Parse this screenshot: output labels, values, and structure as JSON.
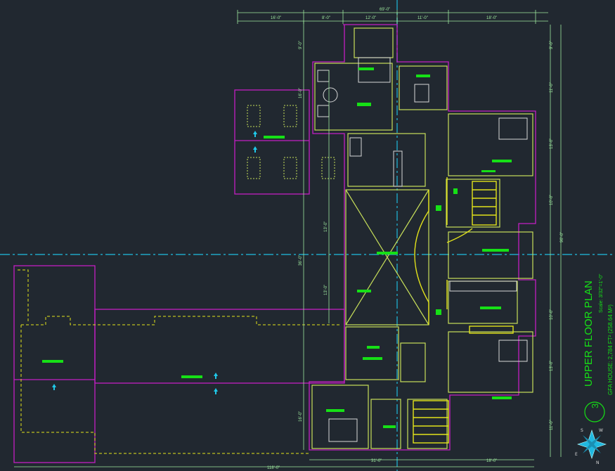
{
  "title": "UPPER FLOOR PLAN",
  "scale": "Scale: 3/32\"=1'-0\"",
  "gfa": "GFA HOUSE: 2,784 FT² (258.64 M²)",
  "number": "3",
  "compass": {
    "n": "N",
    "s": "S",
    "e": "E",
    "w": "W"
  },
  "dims": {
    "top_overall": "69'-0\"",
    "top_1": "16'-0\"",
    "top_2": "8'-0\"",
    "top_3": "12'-0\"",
    "top_4": "11'-0\"",
    "top_5": "18'-0\"",
    "bottom_overall": "118'-0\"",
    "bottom_1": "31'-0\"",
    "bottom_2": "18'-0\"",
    "right_overall": "96'-0\"",
    "right_1": "9'-0\"",
    "right_2": "11'-0\"",
    "right_3": "13'-0\"",
    "right_4": "10'-0\"",
    "right_5": "10'-0\"",
    "right_6": "13'-0\"",
    "right_7": "11'-0\"",
    "left_overall": "36'-0\"",
    "left_1": "9'-0\"",
    "left_2": "16'-0\"",
    "left_3": "13'-0\"",
    "left_4": "13'-0\"",
    "left_5": "16'-0\""
  },
  "colors": {
    "background": "#212830",
    "wall": "#c8e05a",
    "outline": "#c21ec2",
    "label": "#16e016",
    "dimension": "#9ee89e",
    "axis": "#1fa5c4",
    "stair": "#e3e31a",
    "compass": "#20b8e0"
  }
}
